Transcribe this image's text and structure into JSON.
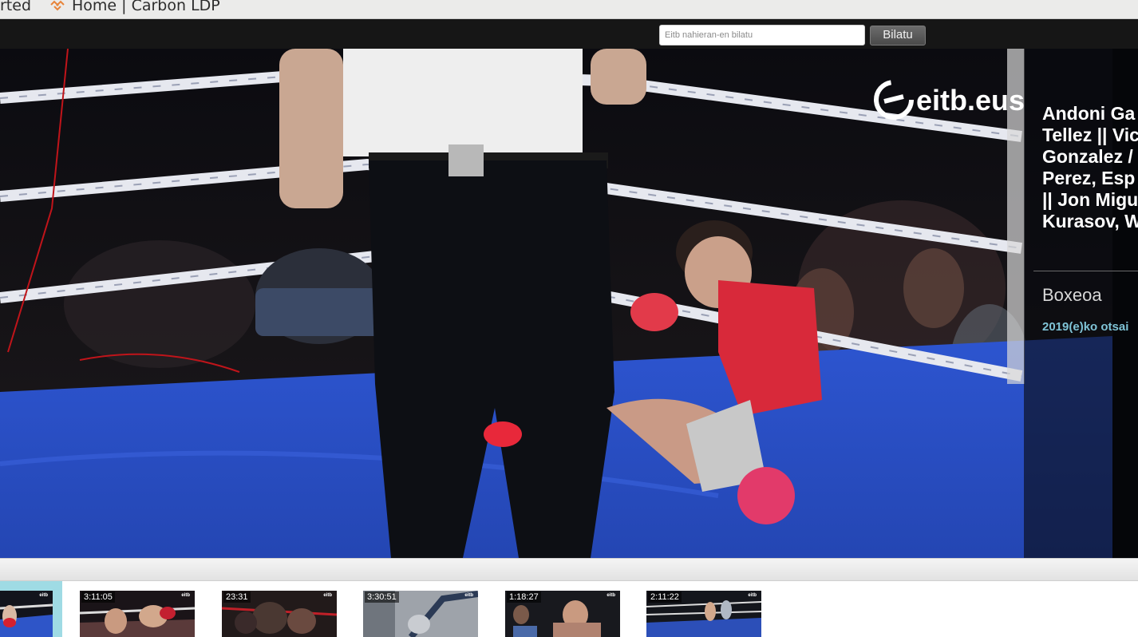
{
  "bookmarks": {
    "partial_item": "rted",
    "home_item": "Home | Carbon LDP",
    "home_icon": "carbon-ldp-icon"
  },
  "header": {
    "search_placeholder": "Eitb nahieran-en bilatu",
    "search_button": "Bilatu"
  },
  "player": {
    "watermark": "eitb.eus",
    "info": {
      "title": "Andoni Ga\nTellez || Vic\nGonzalez /\nPerez, Esp\n|| Jon Migu\nKurasov, W",
      "category": "Boxeoa",
      "date": "2019(e)ko otsai"
    }
  },
  "thumbnails": [
    {
      "duration": ""
    },
    {
      "duration": "3:11:05"
    },
    {
      "duration": "23:31"
    },
    {
      "duration": "3:30:51"
    },
    {
      "duration": "1:18:27"
    },
    {
      "duration": "2:11:22"
    }
  ],
  "colors": {
    "header_bg": "#161616",
    "active_thumb_bg": "#9fdbe4",
    "date_color": "#7fc3d6",
    "ring_canvas": "#2f55c9"
  }
}
